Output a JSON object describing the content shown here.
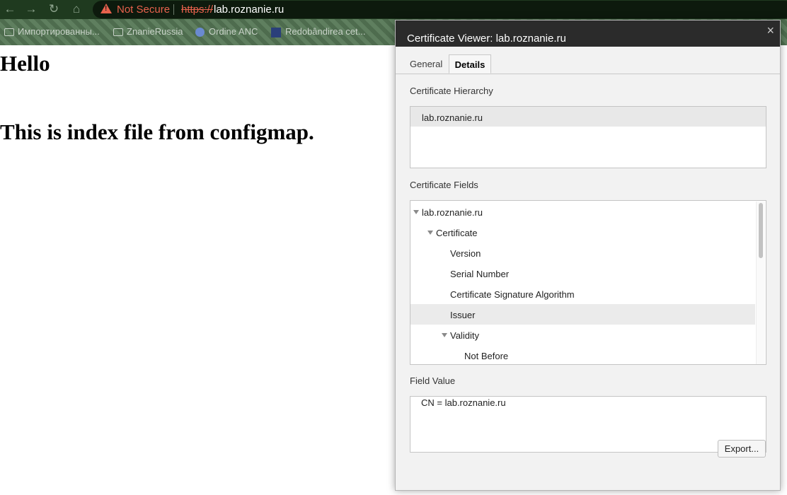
{
  "browser": {
    "nav": {
      "back_icon": "←",
      "forward_icon": "→",
      "reload_icon": "↻",
      "home_icon": "⌂"
    },
    "security_label": "Not Secure",
    "url_scheme": "https://",
    "url_host": "lab.roznanie.ru",
    "bookmarks": [
      {
        "label": "Импортированны...",
        "icon": "folder-icon"
      },
      {
        "label": "ZnanieRussia",
        "icon": "folder-icon"
      },
      {
        "label": "Ordine ANC",
        "icon": "magnifier-icon"
      },
      {
        "label": "Redobândirea cet...",
        "icon": "favicon"
      }
    ]
  },
  "page": {
    "heading": "Hello",
    "subheading": "This is index file from configmap."
  },
  "dialog": {
    "title": "Certificate Viewer: lab.roznanie.ru",
    "close_icon": "×",
    "tabs": [
      {
        "label": "General",
        "active": false
      },
      {
        "label": "Details",
        "active": true
      }
    ],
    "hierarchy_label": "Certificate Hierarchy",
    "hierarchy": [
      "lab.roznanie.ru"
    ],
    "fields_label": "Certificate Fields",
    "fields": [
      {
        "label": "lab.roznanie.ru",
        "level": 0,
        "expanded": true
      },
      {
        "label": "Certificate",
        "level": 1,
        "expanded": true
      },
      {
        "label": "Version",
        "level": 2
      },
      {
        "label": "Serial Number",
        "level": 2
      },
      {
        "label": "Certificate Signature Algorithm",
        "level": 2
      },
      {
        "label": "Issuer",
        "level": 2,
        "selected": true
      },
      {
        "label": "Validity",
        "level": 2,
        "expanded": true
      },
      {
        "label": "Not Before",
        "level": 3
      }
    ],
    "field_value_label": "Field Value",
    "field_value": "CN = lab.roznanie.ru",
    "export_label": "Export..."
  },
  "colors": {
    "warning": "#e8624d",
    "topbar": "#1f3a1f",
    "dialog_header": "#2b2b2b"
  }
}
